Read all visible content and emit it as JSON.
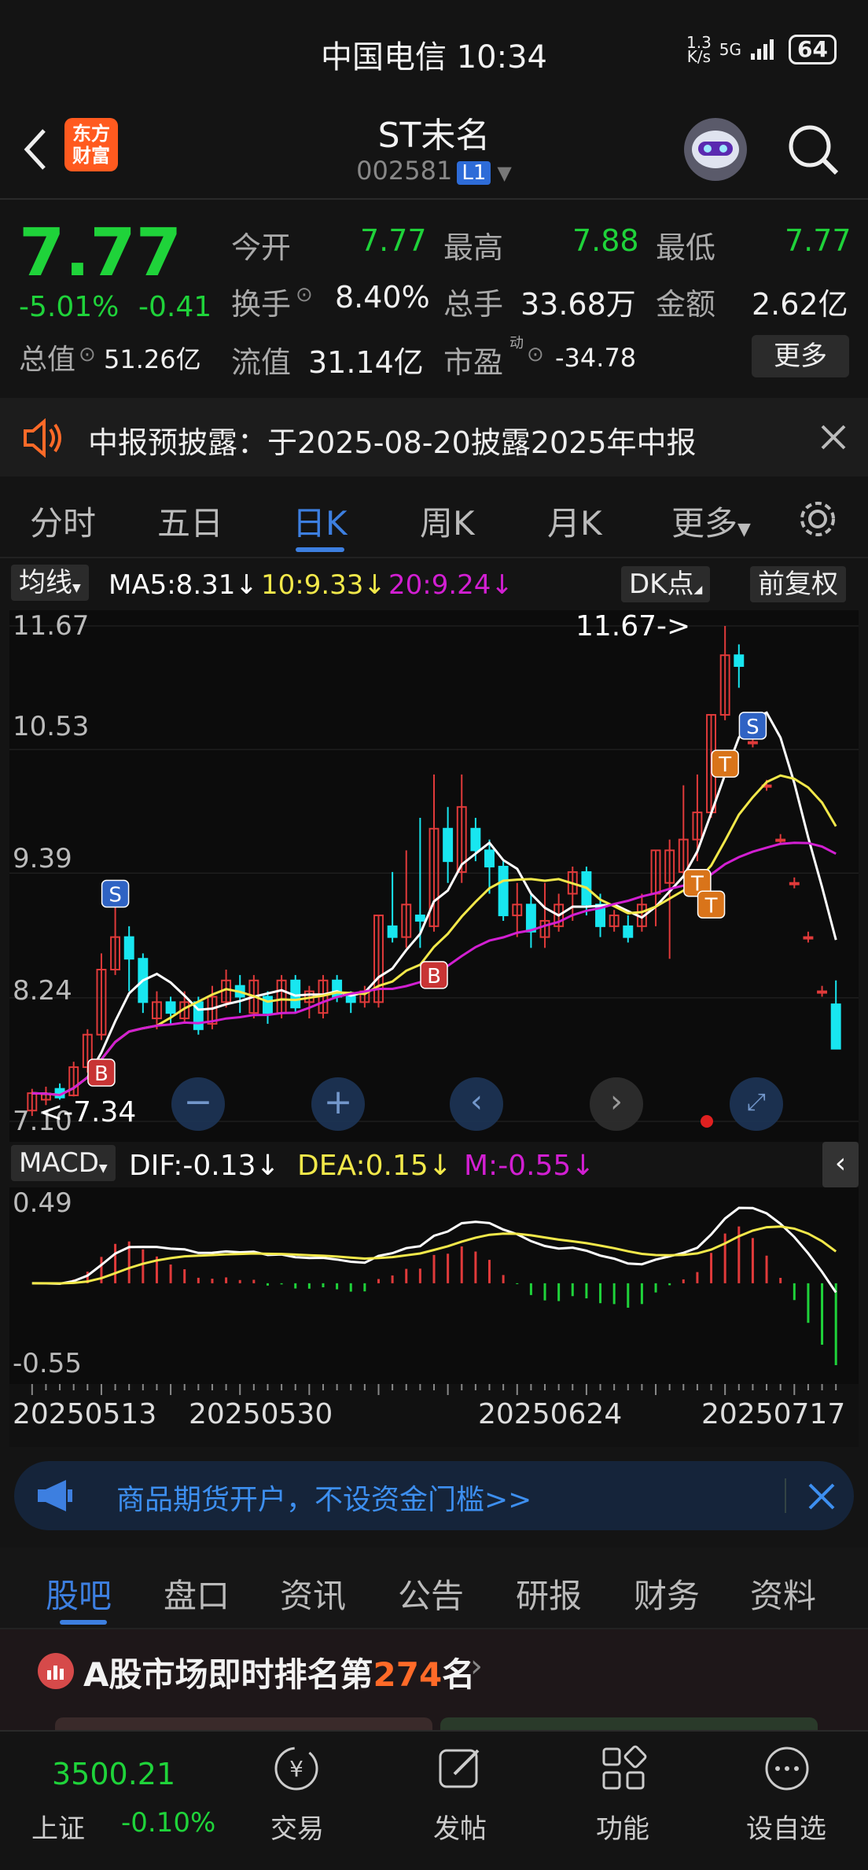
{
  "status": {
    "carrier_time": "中国电信 10:34",
    "speed": "1.3\nK/s",
    "network": "5G",
    "battery": "64"
  },
  "header": {
    "logo_text": "东方\n财富",
    "title": "ST未名",
    "code": "002581",
    "market_badge": "L1"
  },
  "quote": {
    "price": "7.77",
    "change_pct": "-5.01%",
    "change": "-0.41",
    "open_label": "今开",
    "open": "7.77",
    "high_label": "最高",
    "high": "7.88",
    "low_label": "最低",
    "low": "7.77",
    "turnover_label": "换手",
    "turnover": "8.40%",
    "volume_label": "总手",
    "volume": "33.68万",
    "amount_label": "金额",
    "amount": "2.62亿",
    "mktcap_label": "总值",
    "mktcap": "51.26亿",
    "float_label": "流值",
    "float": "31.14亿",
    "pe_label": "市盈",
    "pe_sup": "动",
    "pe": "-34.78",
    "more_label": "更多"
  },
  "notice": {
    "text": "中报预披露：于2025-08-20披露2025年中报"
  },
  "chart_tabs": [
    "分时",
    "五日",
    "日K",
    "周K",
    "月K",
    "更多"
  ],
  "chart_tabs_active": 2,
  "ma_bar": {
    "ma_btn": "均线",
    "ma5": "MA5:8.31↓",
    "ma10": "10:9.33↓",
    "ma20": "20:9.24↓",
    "dk_btn": "DK点",
    "fq_btn": "前复权"
  },
  "kchart": {
    "y_labels": [
      "11.67",
      "10.53",
      "9.39",
      "8.24",
      "7.10"
    ],
    "max_label": "11.67->",
    "min_label": "<-7.34",
    "markers": {
      "s": "S",
      "b": "B",
      "t": "T"
    }
  },
  "macd_bar": {
    "btn": "MACD",
    "dif": "DIF:-0.13↓",
    "dea": "DEA:0.15↓",
    "m": "M:-0.55↓"
  },
  "macd": {
    "y_top": "0.49",
    "y_bottom": "-0.55"
  },
  "dates": [
    "20250513",
    "20250530",
    "20250624",
    "20250717"
  ],
  "ad": {
    "text": "商品期货开户，不设资金门槛>>"
  },
  "bottom_tabs": [
    "股吧",
    "盘口",
    "资讯",
    "公告",
    "研报",
    "财务",
    "资料"
  ],
  "rank": {
    "prefix": "A股市场即时排名第",
    "num": "274",
    "suffix": "名"
  },
  "nav": {
    "index_value": "3500.21",
    "index_name": "上证",
    "index_change": "-0.10%",
    "items": [
      "交易",
      "发帖",
      "功能",
      "设自选"
    ]
  },
  "colors": {
    "up": "#e03a3a",
    "down": "#1fd33a",
    "cyan": "#18e6f0",
    "ma5": "#ffffff",
    "ma10": "#f2e84a",
    "ma20": "#d21fd2",
    "accent": "#3d7fe0"
  },
  "chart_data": {
    "type": "candlestick",
    "x_ticks": [
      "20250513",
      "20250530",
      "20250624",
      "20250717"
    ],
    "ylim": [
      7.1,
      11.67
    ],
    "y_ticks": [
      11.67,
      10.53,
      9.39,
      8.24,
      7.1
    ],
    "candles": [
      [
        7.2,
        7.36,
        7.15,
        7.4
      ],
      [
        7.3,
        7.35,
        7.25,
        7.42
      ],
      [
        7.4,
        7.32,
        7.3,
        7.45
      ],
      [
        7.34,
        7.6,
        7.33,
        7.65
      ],
      [
        7.6,
        7.9,
        7.55,
        7.95
      ],
      [
        7.9,
        8.5,
        7.85,
        8.65
      ],
      [
        8.5,
        8.8,
        8.45,
        9.2
      ],
      [
        8.8,
        8.6,
        8.3,
        8.9
      ],
      [
        8.6,
        8.2,
        8.1,
        8.65
      ],
      [
        8.05,
        8.2,
        7.95,
        8.3
      ],
      [
        8.2,
        8.1,
        8.0,
        8.25
      ],
      [
        8.05,
        8.2,
        8.0,
        8.3
      ],
      [
        8.2,
        7.95,
        7.9,
        8.25
      ],
      [
        8.0,
        8.25,
        7.95,
        8.35
      ],
      [
        8.2,
        8.4,
        8.15,
        8.5
      ],
      [
        8.35,
        8.25,
        8.1,
        8.45
      ],
      [
        8.1,
        8.4,
        8.05,
        8.45
      ],
      [
        8.25,
        8.1,
        8.0,
        8.3
      ],
      [
        8.1,
        8.4,
        8.05,
        8.45
      ],
      [
        8.4,
        8.15,
        8.1,
        8.45
      ],
      [
        8.2,
        8.3,
        8.05,
        8.35
      ],
      [
        8.1,
        8.4,
        8.05,
        8.45
      ],
      [
        8.4,
        8.25,
        8.2,
        8.45
      ],
      [
        8.25,
        8.2,
        8.1,
        8.3
      ],
      [
        8.2,
        8.3,
        8.15,
        8.35
      ],
      [
        8.2,
        9.0,
        8.15,
        9.0
      ],
      [
        8.9,
        8.8,
        8.75,
        9.4
      ],
      [
        8.8,
        9.1,
        8.7,
        9.6
      ],
      [
        9.0,
        8.95,
        8.7,
        9.9
      ],
      [
        8.9,
        9.8,
        8.85,
        10.3
      ],
      [
        9.8,
        9.5,
        9.3,
        10.0
      ],
      [
        9.4,
        10.0,
        9.3,
        10.3
      ],
      [
        9.8,
        9.6,
        9.5,
        9.9
      ],
      [
        9.6,
        9.45,
        9.2,
        9.7
      ],
      [
        9.45,
        9.0,
        8.95,
        9.5
      ],
      [
        9.0,
        9.1,
        8.8,
        9.3
      ],
      [
        9.1,
        8.85,
        8.7,
        9.2
      ],
      [
        8.8,
        8.95,
        8.7,
        9.3
      ],
      [
        8.9,
        9.1,
        8.85,
        9.2
      ],
      [
        9.2,
        9.4,
        8.95,
        9.45
      ],
      [
        9.4,
        9.1,
        9.0,
        9.45
      ],
      [
        9.1,
        8.9,
        8.8,
        9.2
      ],
      [
        8.9,
        9.0,
        8.85,
        9.05
      ],
      [
        8.9,
        8.8,
        8.75,
        9.0
      ],
      [
        8.9,
        9.1,
        8.85,
        9.2
      ],
      [
        9.2,
        9.6,
        8.9,
        9.6
      ],
      [
        9.3,
        9.6,
        8.6,
        9.7
      ],
      [
        9.4,
        9.7,
        9.35,
        10.2
      ],
      [
        9.7,
        9.95,
        9.5,
        10.3
      ],
      [
        9.95,
        10.85,
        9.9,
        10.85
      ],
      [
        10.85,
        11.4,
        10.8,
        11.67
      ],
      [
        11.4,
        11.3,
        11.1,
        11.5
      ],
      [
        10.6,
        10.6,
        10.55,
        10.65
      ],
      [
        10.2,
        10.2,
        10.15,
        10.25
      ],
      [
        9.7,
        9.7,
        9.65,
        9.75
      ],
      [
        9.3,
        9.3,
        9.25,
        9.35
      ],
      [
        8.8,
        8.8,
        8.75,
        8.85
      ],
      [
        8.3,
        8.3,
        8.25,
        8.35
      ],
      [
        8.18,
        7.77,
        7.77,
        8.4
      ]
    ],
    "series": [
      {
        "name": "MA5",
        "value": 8.31
      },
      {
        "name": "MA10",
        "value": 9.33
      },
      {
        "name": "MA20",
        "value": 9.24
      }
    ],
    "macd": {
      "dif": -0.13,
      "dea": 0.15,
      "m": -0.55,
      "ylim": [
        -0.55,
        0.49
      ]
    }
  }
}
